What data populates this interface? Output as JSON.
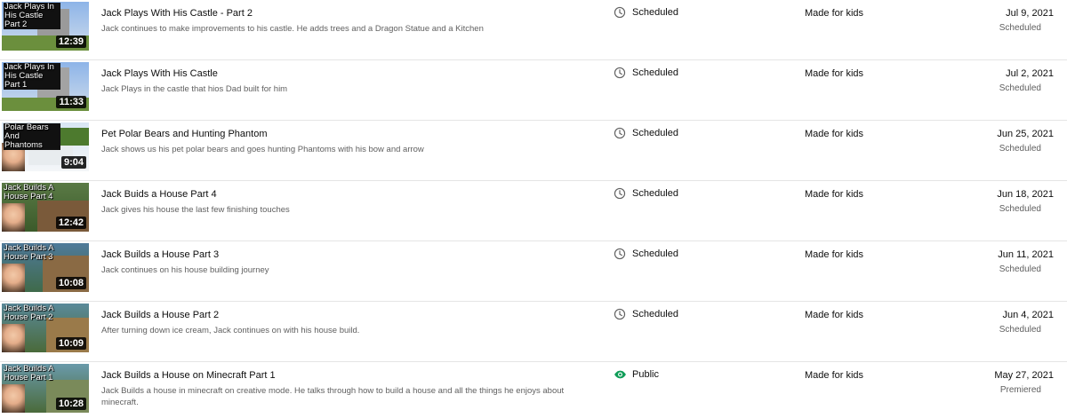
{
  "rows": [
    {
      "title": "Jack Plays With His Castle - Part 2",
      "description": "Jack continues to make improvements to his castle. He adds trees and a Dragon Statue and a Kitchen",
      "thumb_text": "Jack Plays In His Castle Part 2",
      "duration": "12:39",
      "visibility": "Scheduled",
      "visibility_icon": "clock-icon",
      "restrictions": "Made for kids",
      "date": "Jul 9, 2021",
      "date_status": "Scheduled"
    },
    {
      "title": "Jack Plays With His Castle",
      "description": "Jack Plays in the castle that hios Dad built for him",
      "thumb_text": "Jack Plays In His Castle Part 1",
      "duration": "11:33",
      "visibility": "Scheduled",
      "visibility_icon": "clock-icon",
      "restrictions": "Made for kids",
      "date": "Jul 2, 2021",
      "date_status": "Scheduled"
    },
    {
      "title": "Pet Polar Bears and Hunting Phantom",
      "description": "Jack shows us his pet polar bears and goes hunting Phantoms with his bow and arrow",
      "thumb_text": "Polar Bears And Phantoms",
      "duration": "9:04",
      "visibility": "Scheduled",
      "visibility_icon": "clock-icon",
      "restrictions": "Made for kids",
      "date": "Jun 25, 2021",
      "date_status": "Scheduled"
    },
    {
      "title": "Jack Buids a House Part 4",
      "description": "Jack gives his house the last few finishing touches",
      "thumb_text": "Jack Builds A House Part 4",
      "duration": "12:42",
      "visibility": "Scheduled",
      "visibility_icon": "clock-icon",
      "restrictions": "Made for kids",
      "date": "Jun 18, 2021",
      "date_status": "Scheduled"
    },
    {
      "title": "Jack Builds a House Part 3",
      "description": "Jack continues on his house building journey",
      "thumb_text": "Jack Builds A House Part 3",
      "duration": "10:08",
      "visibility": "Scheduled",
      "visibility_icon": "clock-icon",
      "restrictions": "Made for kids",
      "date": "Jun 11, 2021",
      "date_status": "Scheduled"
    },
    {
      "title": "Jack Builds a House Part 2",
      "description": "After turning down ice cream, Jack continues on with his house build.",
      "thumb_text": "Jack Builds A House Part 2",
      "duration": "10:09",
      "visibility": "Scheduled",
      "visibility_icon": "clock-icon",
      "restrictions": "Made for kids",
      "date": "Jun 4, 2021",
      "date_status": "Scheduled"
    },
    {
      "title": "Jack Builds a House on Minecraft Part 1",
      "description": "Jack Builds a house in minecraft on creative mode. He talks through how to build a house and all the things he enjoys about minecraft.",
      "thumb_text": "Jack Builds A House Part 1",
      "duration": "10:28",
      "visibility": "Public",
      "visibility_icon": "eye-icon",
      "restrictions": "Made for kids",
      "date": "May 27, 2021",
      "date_status": "Premiered"
    }
  ],
  "colors": {
    "public_icon": "#0f9d58",
    "scheduled_icon": "#606060",
    "secondary_text": "#606060",
    "divider": "#e5e5e5"
  }
}
